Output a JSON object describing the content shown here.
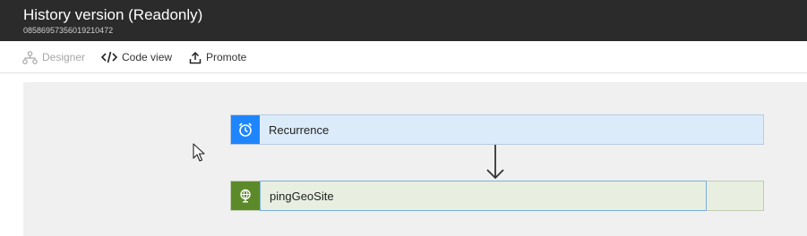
{
  "header": {
    "title": "History version (Readonly)",
    "subtitle": "08586957356019210472"
  },
  "toolbar": {
    "designer_label": "Designer",
    "codeview_label": "Code view",
    "promote_label": "Promote"
  },
  "workflow": {
    "steps": [
      {
        "label": "Recurrence",
        "icon": "alarm-clock-icon",
        "color": "#1f85ff"
      },
      {
        "label": "pingGeoSite",
        "icon": "globe-icon",
        "color": "#5c8a2a"
      }
    ]
  }
}
